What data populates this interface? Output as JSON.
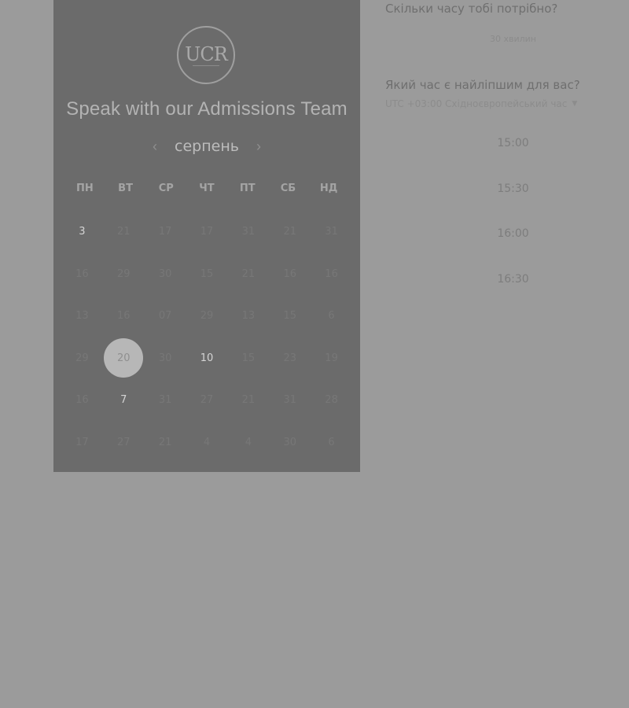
{
  "panel": {
    "logo_text": "UCR",
    "heading": "Speak with our Admissions Team",
    "month": "серпень",
    "weekdays": [
      "ПН",
      "ВТ",
      "СР",
      "ЧТ",
      "ПТ",
      "СБ",
      "НД"
    ],
    "days": [
      {
        "label": "3",
        "state": "available"
      },
      {
        "label": "21",
        "state": "disabled"
      },
      {
        "label": "17",
        "state": "disabled"
      },
      {
        "label": "17",
        "state": "disabled"
      },
      {
        "label": "31",
        "state": "disabled"
      },
      {
        "label": "21",
        "state": "disabled"
      },
      {
        "label": "31",
        "state": "disabled"
      },
      {
        "label": "16",
        "state": "disabled"
      },
      {
        "label": "29",
        "state": "disabled"
      },
      {
        "label": "30",
        "state": "disabled"
      },
      {
        "label": "15",
        "state": "disabled"
      },
      {
        "label": "21",
        "state": "disabled"
      },
      {
        "label": "16",
        "state": "disabled"
      },
      {
        "label": "16",
        "state": "disabled"
      },
      {
        "label": "13",
        "state": "disabled"
      },
      {
        "label": "16",
        "state": "disabled"
      },
      {
        "label": "07",
        "state": "disabled"
      },
      {
        "label": "29",
        "state": "disabled"
      },
      {
        "label": "13",
        "state": "disabled"
      },
      {
        "label": "15",
        "state": "disabled"
      },
      {
        "label": "6",
        "state": "disabled"
      },
      {
        "label": "29",
        "state": "disabled"
      },
      {
        "label": "20",
        "state": "selected"
      },
      {
        "label": "30",
        "state": "disabled"
      },
      {
        "label": "10",
        "state": "available"
      },
      {
        "label": "15",
        "state": "disabled"
      },
      {
        "label": "23",
        "state": "disabled"
      },
      {
        "label": "19",
        "state": "disabled"
      },
      {
        "label": "16",
        "state": "disabled"
      },
      {
        "label": "7",
        "state": "available"
      },
      {
        "label": "31",
        "state": "disabled"
      },
      {
        "label": "27",
        "state": "disabled"
      },
      {
        "label": "21",
        "state": "disabled"
      },
      {
        "label": "31",
        "state": "disabled"
      },
      {
        "label": "28",
        "state": "disabled"
      },
      {
        "label": "17",
        "state": "disabled"
      },
      {
        "label": "27",
        "state": "disabled"
      },
      {
        "label": "21",
        "state": "disabled"
      },
      {
        "label": "4",
        "state": "disabled"
      },
      {
        "label": "4",
        "state": "disabled"
      },
      {
        "label": "30",
        "state": "disabled"
      },
      {
        "label": "6",
        "state": "disabled"
      }
    ]
  },
  "right": {
    "duration_question": "Скільки часу тобі потрібно?",
    "duration_value": "30 хвилин",
    "time_question": "Який час є найліпшим для вас?",
    "timezone": "UTC +03:00 Східноєвропейський час",
    "slots": [
      "15:00",
      "15:30",
      "16:00",
      "16:30"
    ]
  },
  "colors": {
    "page_bg": "#9b9b9b",
    "panel_bg": "#6b6b6b",
    "selected_day": "#b7b7b7"
  },
  "icons": {
    "prev": "chevron-left-icon",
    "next": "chevron-right-icon",
    "timezone_dropdown": "caret-down-icon"
  }
}
